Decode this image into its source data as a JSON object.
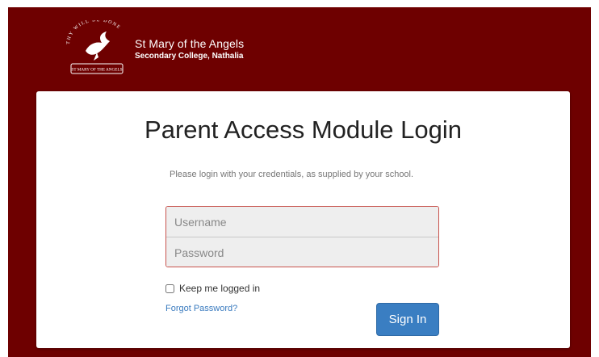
{
  "header": {
    "school_line1": "St Mary of the Angels",
    "school_line2": "Secondary College, Nathalia",
    "logo": {
      "motto": "THY WILL BE DONE",
      "banner": "ST MARY OF THE ANGELS",
      "icon": "dove-icon"
    }
  },
  "login": {
    "title": "Parent Access Module Login",
    "instruction": "Please login with your credentials, as supplied by your school.",
    "username_placeholder": "Username",
    "password_placeholder": "Password",
    "username_value": "",
    "password_value": "",
    "keep_logged_in_label": "Keep me logged in",
    "keep_logged_in_checked": false,
    "forgot_password_label": "Forgot Password?",
    "sign_in_label": "Sign In"
  },
  "colors": {
    "brand_maroon": "#6e0000",
    "button_blue": "#3a7ec2",
    "link_blue": "#3a7bbf",
    "field_border_error": "#c8534d"
  }
}
